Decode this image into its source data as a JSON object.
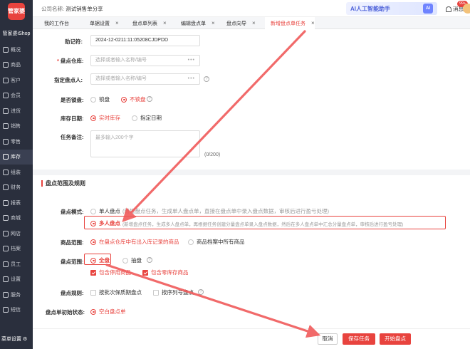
{
  "sidebar": {
    "logo_mark": "管家婆",
    "logo_text": "管家婆iShop",
    "items": [
      {
        "label": "概况",
        "icon": "overview-icon"
      },
      {
        "label": "商品",
        "icon": "goods-icon"
      },
      {
        "label": "客户",
        "icon": "customer-icon"
      },
      {
        "label": "会员",
        "icon": "member-icon"
      },
      {
        "label": "进货",
        "icon": "purchase-icon"
      },
      {
        "label": "销售",
        "icon": "sales-icon"
      },
      {
        "label": "零售",
        "icon": "retail-icon"
      },
      {
        "label": "库存",
        "icon": "inventory-icon"
      },
      {
        "label": "组装",
        "icon": "assembly-icon"
      },
      {
        "label": "财务",
        "icon": "finance-icon"
      },
      {
        "label": "报表",
        "icon": "report-icon"
      },
      {
        "label": "商城",
        "icon": "mall-icon"
      },
      {
        "label": "网店",
        "icon": "webstore-icon"
      },
      {
        "label": "档案",
        "icon": "archive-icon"
      },
      {
        "label": "员工",
        "icon": "staff-icon"
      },
      {
        "label": "设置",
        "icon": "settings-icon"
      },
      {
        "label": "服务",
        "icon": "service-icon"
      },
      {
        "label": "短信",
        "icon": "sms-icon"
      }
    ],
    "active_index": 7,
    "menu_settings": "菜单设置"
  },
  "header": {
    "company_label": "公司名称:",
    "company_name": "测试销售单分享",
    "ai_label": "AI人工智能助手",
    "ai_badge": "AI",
    "message_label": "消息",
    "message_count": "99+"
  },
  "tabs": [
    {
      "label": "我的工作台",
      "closable": false
    },
    {
      "label": "单据设置",
      "closable": true
    },
    {
      "label": "盘点单列表",
      "closable": true
    },
    {
      "label": "编辑盘点单",
      "closable": true
    },
    {
      "label": "盘点向导",
      "closable": true
    },
    {
      "label": "新增盘点单任务",
      "closable": true
    }
  ],
  "active_tab": 5,
  "form": {
    "doc_no_label": "助记符:",
    "doc_no_value": "2024-12-0211:11:05208CJDPDD",
    "warehouse_label": "盘点仓库:",
    "warehouse_placeholder": "选择或者输入名称/编号",
    "person_label": "指定盘点人:",
    "person_placeholder": "选择或者输入名称/编号",
    "lock_label": "是否锁盘:",
    "lock_options": [
      "锁盘",
      "不锁盘"
    ],
    "lock_selected": 1,
    "stock_date_label": "库存日期:",
    "stock_date_options": [
      "实时库存",
      "指定日期"
    ],
    "stock_date_selected": 0,
    "remark_label": "任务备注:",
    "remark_placeholder": "最多输入200个字",
    "remark_count": "(0/200)",
    "dots": "•••"
  },
  "section": {
    "title": "盘点范围及规则",
    "mode_label": "盘点模式:",
    "mode_single": "单人盘点",
    "mode_single_desc": "(新增盘点任务，生成单人盘点单，直接在盘点单中录入盘点数据，审核后进行盈亏处理)",
    "mode_multi": "多人盘点",
    "mode_multi_desc": "(新增盘点任务，生成多人盘点单，再根据任务创建分量盘点单录入盘点数据，然后在多人盘点单中汇总分量盘点单，审核后进行盈亏处理)",
    "goods_range_label": "商品范围:",
    "goods_range_opt1": "在盘点仓库中有出入库记录的商品",
    "goods_range_opt2": "商品档案中所有商品",
    "scope_label": "盘点范围:",
    "scope_all": "全盘",
    "scope_sample": "抽盘",
    "check_disabled": "包含停用商品",
    "check_zero": "包含零库存商品",
    "rule_label": "盘点规则:",
    "rule_batch": "按批次保质期盘点",
    "rule_serial": "按序列号盘点",
    "init_label": "盘点单初始状态:",
    "init_value": "空白盘点单"
  },
  "footer": {
    "cancel": "取消",
    "save": "保存任务",
    "start": "开始盘点"
  },
  "colors": {
    "accent": "#e8433e",
    "sidebar": "#2a2f3d"
  }
}
